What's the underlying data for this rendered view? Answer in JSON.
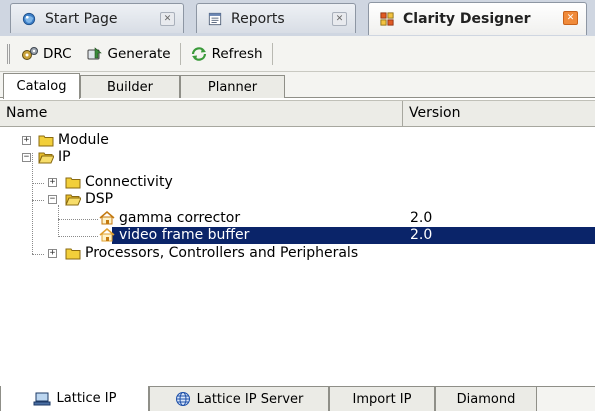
{
  "editor_tabs": [
    {
      "label": "Start Page",
      "icon": "start-page-icon"
    },
    {
      "label": "Reports",
      "icon": "reports-icon"
    },
    {
      "label": "Clarity Designer",
      "icon": "clarity-designer-icon"
    }
  ],
  "toolbar": {
    "drc": "DRC",
    "generate": "Generate",
    "refresh": "Refresh"
  },
  "sub_tabs": [
    "Catalog",
    "Builder",
    "Planner"
  ],
  "columns": {
    "name": "Name",
    "version": "Version"
  },
  "tree": [
    {
      "label": "Module",
      "version": ""
    },
    {
      "label": "IP",
      "version": ""
    },
    {
      "label": "Connectivity",
      "version": ""
    },
    {
      "label": "DSP",
      "version": ""
    },
    {
      "label": "gamma corrector",
      "version": "2.0"
    },
    {
      "label": "video frame buffer",
      "version": "2.0"
    },
    {
      "label": "Processors, Controllers and Peripherals",
      "version": ""
    }
  ],
  "bottom_tabs": [
    "Lattice IP",
    "Lattice IP Server",
    "Import IP",
    "Diamond"
  ],
  "colors": {
    "selection": "#0a2469",
    "active_close": "#f08a3a",
    "folder": "#f2cf3a"
  }
}
